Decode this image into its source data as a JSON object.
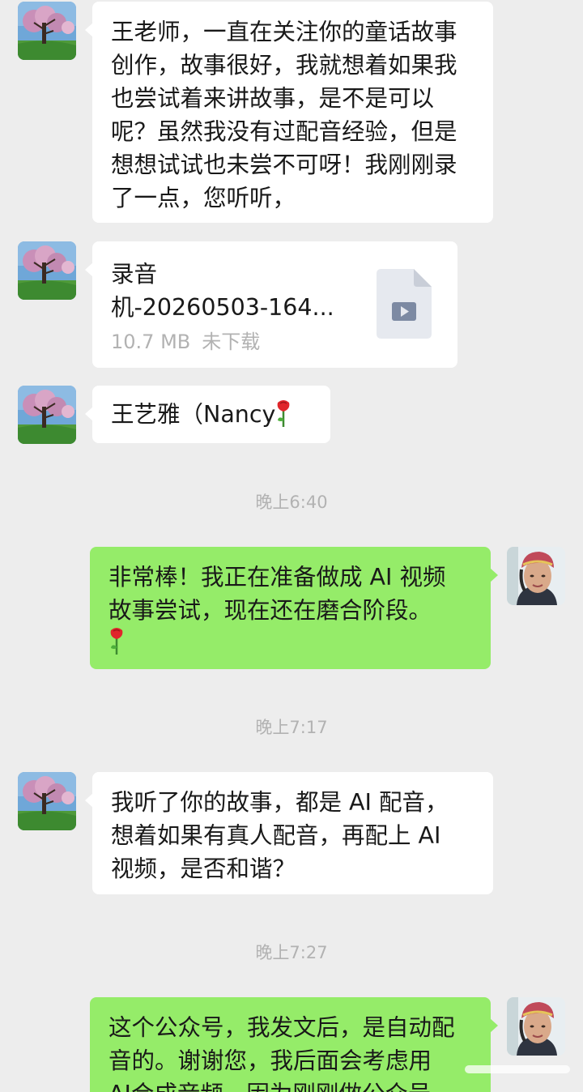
{
  "messages": [
    {
      "type": "text",
      "lines": [
        "王老师，一直在关注你的童话故事",
        "创作，故事很好，我就想着如果我",
        "也尝试着来讲故事，是不是可以",
        "呢？虽然我没有过配音经验，但是",
        "想想试试也未尝不可呀！我刚刚录",
        "了一点，您听听，"
      ]
    },
    {
      "type": "file",
      "name_line1": "录音",
      "name_line2": "机-20260503-164...",
      "size": "10.7 MB",
      "status": "未下载"
    },
    {
      "type": "text",
      "text": "王艺雅（Nancy",
      "emoji": "rose-emoji"
    },
    {
      "type": "time",
      "text": "晚上6:40"
    },
    {
      "type": "text",
      "lines": [
        "非常棒！我正在准备做成 AI 视频",
        "故事尝试，现在还在磨合阶段。"
      ],
      "emoji": "rose-emoji"
    },
    {
      "type": "time",
      "text": "晚上7:17"
    },
    {
      "type": "text",
      "lines": [
        "我听了你的故事，都是 AI 配音，",
        "想着如果有真人配音，再配上 AI",
        "视频，是否和谐？"
      ]
    },
    {
      "type": "time",
      "text": "晚上7:27"
    },
    {
      "type": "text",
      "lines": [
        "这个公众号，我发文后，是自动配",
        "音的。谢谢您，我后面会考虑用",
        "AI合成音频，因为刚刚做公众号"
      ]
    }
  ],
  "colors": {
    "background": "#ededed",
    "incoming_bubble": "#ffffff",
    "outgoing_bubble": "#95ec69",
    "timestamp": "#b2b2b2"
  }
}
